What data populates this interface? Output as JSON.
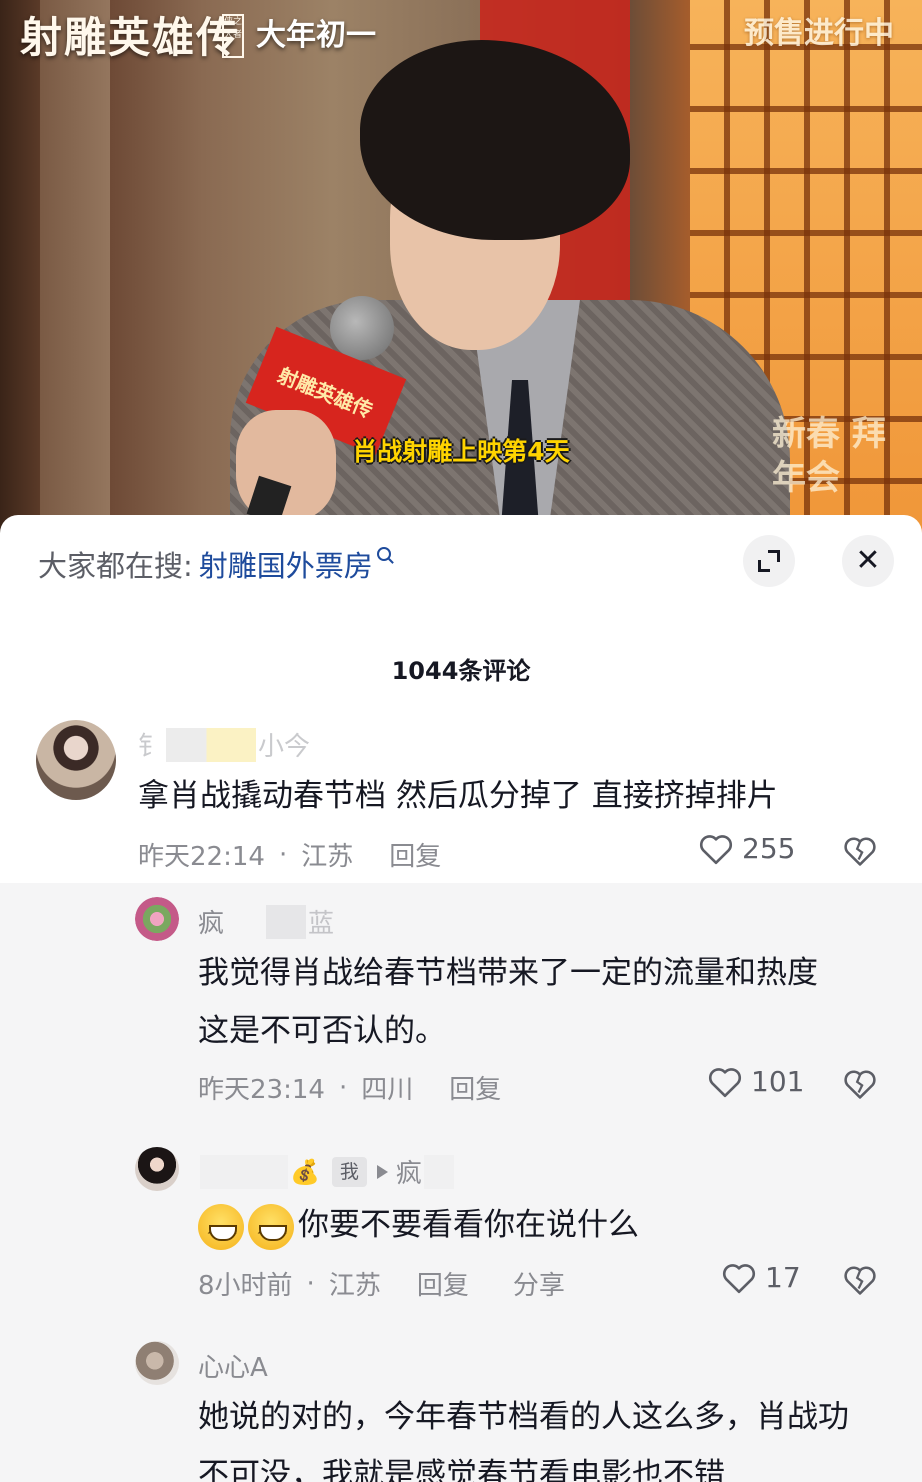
{
  "video": {
    "show_logo": "射雕英雄传",
    "show_logo_seal": "侠之大者",
    "release_text": "大年初一",
    "presale_text": "预售进行中",
    "corner_watermark": "新春 拜年会",
    "mic_flag_text": "射雕英雄传",
    "subtitle": "肖战射雕上映第4天"
  },
  "sheet": {
    "search_prefix": "大家都在搜:",
    "search_term": "射雕国外票房",
    "comment_count_label": "1044条评论"
  },
  "comments": [
    {
      "name_prefix": "钅",
      "name_suffix": "小今",
      "text": "拿肖战撬动春节档  然后瓜分掉了  直接挤掉排片",
      "time": "昨天22:14",
      "location": "江苏",
      "reply_label": "回复",
      "likes": "255"
    },
    {
      "name_prefix": "疯",
      "name_suffix": "蓝",
      "text_line1": "我觉得肖战给春节档带来了一定的流量和热度",
      "text_line2": "这是不可否认的。",
      "time": "昨天23:14",
      "location": "四川",
      "reply_label": "回复",
      "likes": "101"
    },
    {
      "name_prefix": "",
      "me_tag": "我",
      "reply_to": "疯",
      "text": "你要不要看看你在说什么",
      "time": "8小时前",
      "location": "江苏",
      "reply_label": "回复",
      "share_label": "分享",
      "likes": "17"
    },
    {
      "name": "心心A",
      "text_line1": "她说的对的，今年春节档看的人这么多，肖战功",
      "text_line2": "不可没，我就是感觉春节看电影也不错"
    }
  ],
  "colors": {
    "accent_link": "#1e4b9c",
    "subtitle_yellow": "#ffd400",
    "muted_text": "#8a8b91",
    "reply_background": "#f5f5f6"
  },
  "icons": [
    "search-icon",
    "expand-icon",
    "close-icon",
    "heart-icon",
    "dislike-icon"
  ]
}
